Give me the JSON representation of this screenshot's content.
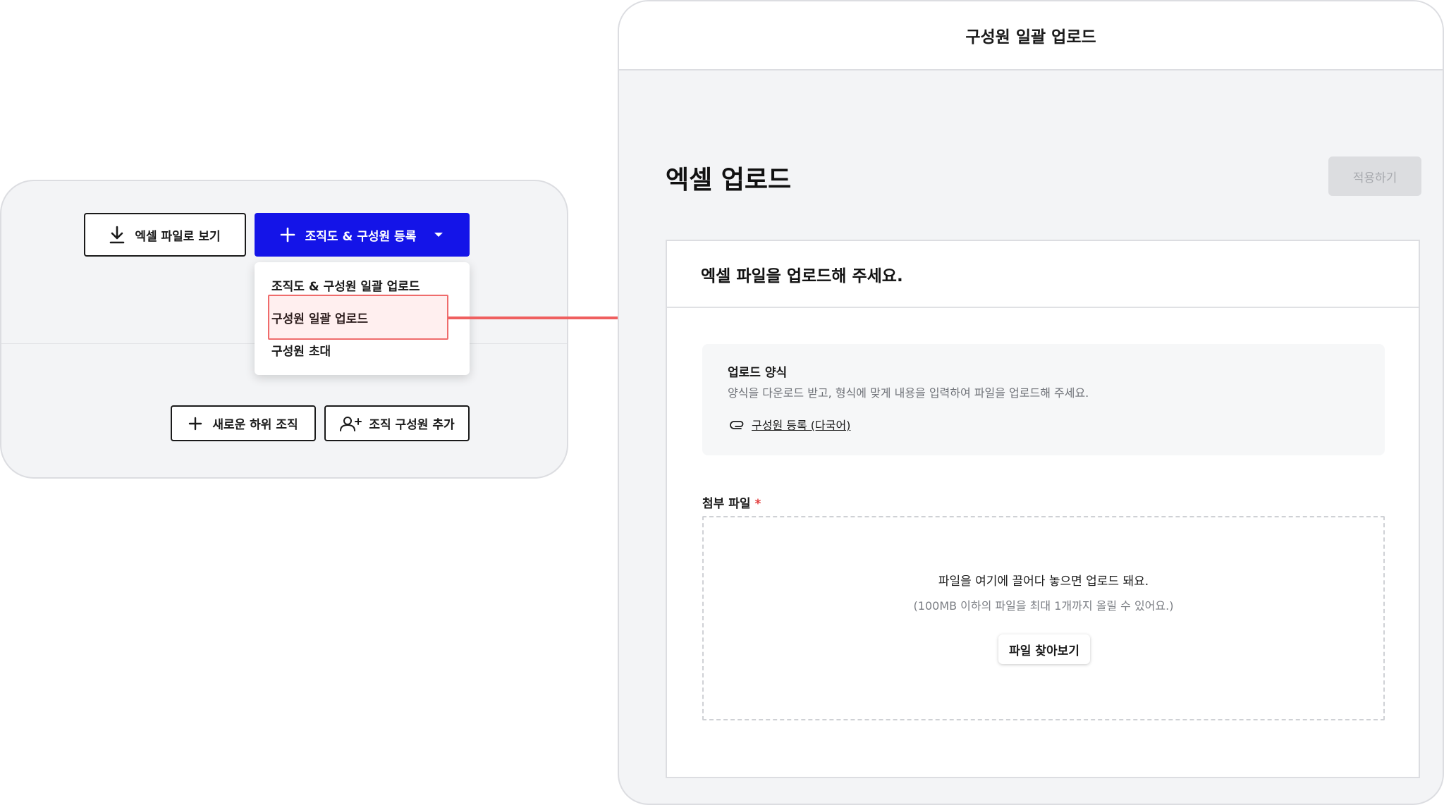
{
  "left": {
    "excel_view_label": "엑셀 파일로 보기",
    "register_label": "조직도 & 구성원 등록",
    "dropdown_items": [
      "조직도 & 구성원 일괄 업로드",
      "구성원 일괄 업로드",
      "구성원 초대"
    ],
    "new_sub_org_label": "새로운 하위 조직",
    "add_member_label": "조직 구성원 추가"
  },
  "modal": {
    "header_title": "구성원 일괄 업로드",
    "page_title": "엑셀 업로드",
    "apply_label": "적용하기",
    "card_title": "엑셀 파일을 업로드해 주세요.",
    "template": {
      "title": "업로드 양식",
      "description": "양식을 다운로드 받고, 형식에 맞게 내용을 입력하여 파일을 업로드해 주세요.",
      "link_label": "구성원 등록 (다국어)"
    },
    "attach_label": "첨부 파일",
    "required_mark": "*",
    "dropzone": {
      "line1": "파일을 여기에 끌어다 놓으면 업로드 돼요.",
      "line2": "(100MB 이하의 파일을 최대 1개까지 올릴 수 있어요.)",
      "browse_label": "파일 찾아보기"
    }
  },
  "colors": {
    "primary": "#1414e8",
    "highlight": "#ef6b6b",
    "arrow": "#ef5f5f",
    "required": "#e23b3b"
  }
}
